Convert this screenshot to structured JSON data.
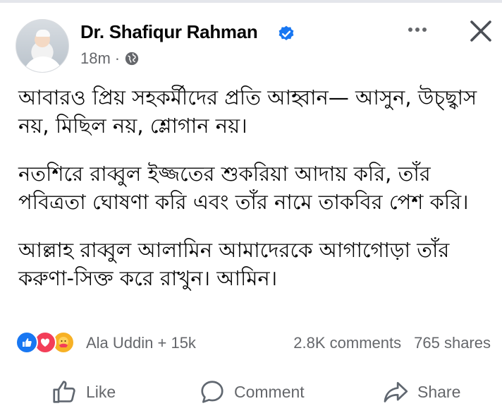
{
  "author": {
    "name": "Dr. Shafiqur Rahman",
    "verified": true,
    "time": "18m",
    "audience_icon": "globe-icon"
  },
  "header_icons": [
    "more-options-icon",
    "close-icon"
  ],
  "post": {
    "paragraphs": [
      "আবারও প্রিয় সহকর্মীদের প্রতি আহ্বান— আসুন, উচ্ছ্বাস নয়, মিছিল নয়, শ্লোগান নয়।",
      "নতশিরে রাব্বুল ইজ্জতের শুকরিয়া আদায় করি, তাঁর পবিত্রতা ঘোষণা করি এবং তাঁর নামে তাকবির পেশ করি।",
      "আল্লাহ রাব্বুল আলামিন আমাদেরকে আগাগোড়া তাঁর করুণা-সিক্ত করে রাখুন। আমিন।"
    ]
  },
  "reactions": {
    "types": [
      "like",
      "love",
      "care"
    ],
    "summary": "Ala Uddin + 15k"
  },
  "stats": {
    "comments": "2.8K comments",
    "shares": "765 shares"
  },
  "actions": {
    "like": "Like",
    "comment": "Comment",
    "share": "Share"
  },
  "colors": {
    "like_blue": "#1877f2",
    "love_red": "#f33e58",
    "care_yellow": "#f7b125",
    "secondary_text": "#65676b"
  }
}
